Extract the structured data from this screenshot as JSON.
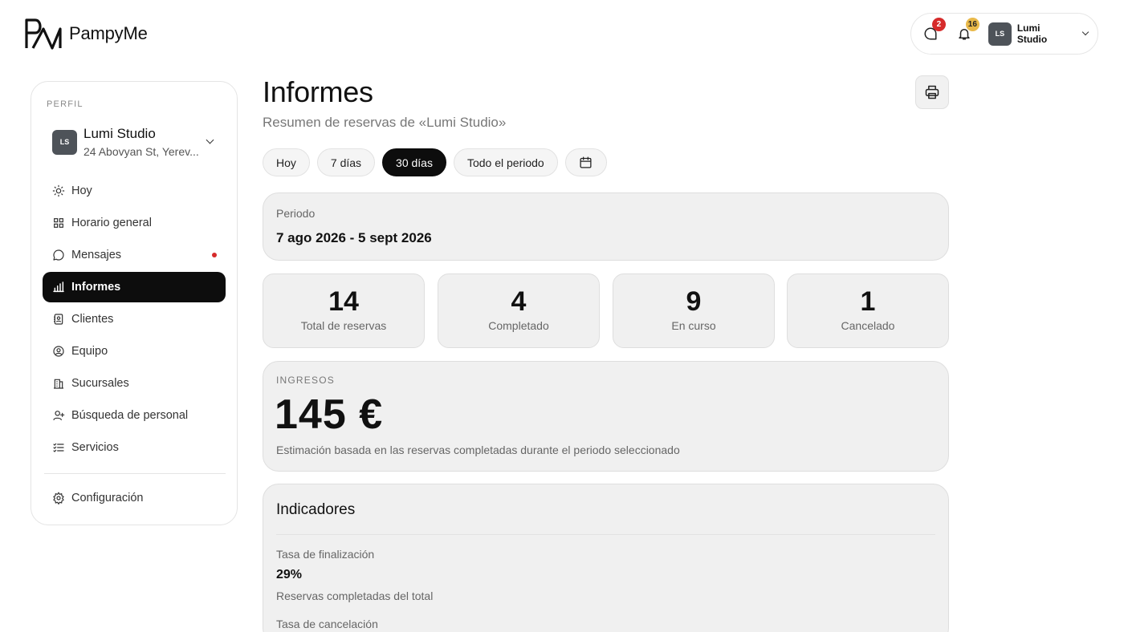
{
  "brand": {
    "name": "PampyMe"
  },
  "topbar": {
    "messages_count": "2",
    "notifications_count": "16",
    "user_initials": "LS",
    "user_name": "Lumi Studio"
  },
  "sidebar": {
    "section_label": "PERFIL",
    "profile": {
      "initials": "LS",
      "name": "Lumi Studio",
      "address": "24 Abovyan St, Yerev..."
    },
    "items": [
      {
        "label": "Hoy",
        "icon": "sun-icon"
      },
      {
        "label": "Horario general",
        "icon": "grid-icon"
      },
      {
        "label": "Mensajes",
        "icon": "chat-icon",
        "has_dot": true
      },
      {
        "label": "Informes",
        "icon": "bar-chart-icon",
        "active": true
      },
      {
        "label": "Clientes",
        "icon": "contacts-icon"
      },
      {
        "label": "Equipo",
        "icon": "user-circle-icon"
      },
      {
        "label": "Sucursales",
        "icon": "building-icon"
      },
      {
        "label": "Búsqueda de personal",
        "icon": "user-plus-icon"
      },
      {
        "label": "Servicios",
        "icon": "checklist-icon"
      }
    ],
    "settings_label": "Configuración"
  },
  "main": {
    "title": "Informes",
    "subtitle": "Resumen de reservas de «Lumi Studio»",
    "filters": [
      "Hoy",
      "7 días",
      "30 días",
      "Todo el periodo"
    ],
    "active_filter": "30 días",
    "period": {
      "label": "Periodo",
      "value": "7 ago 2026 - 5 sept 2026"
    },
    "stats": [
      {
        "value": "14",
        "label": "Total de reservas"
      },
      {
        "value": "4",
        "label": "Completado"
      },
      {
        "value": "9",
        "label": "En curso"
      },
      {
        "value": "1",
        "label": "Cancelado"
      }
    ],
    "income": {
      "label": "INGRESOS",
      "value": "145 €",
      "note": "Estimación basada en las reservas completadas durante el periodo seleccionado"
    },
    "indicators": {
      "title": "Indicadores",
      "metrics": [
        {
          "label": "Tasa de finalización",
          "value": "29%",
          "note": "Reservas completadas del total"
        },
        {
          "label": "Tasa de cancelación"
        }
      ]
    }
  }
}
